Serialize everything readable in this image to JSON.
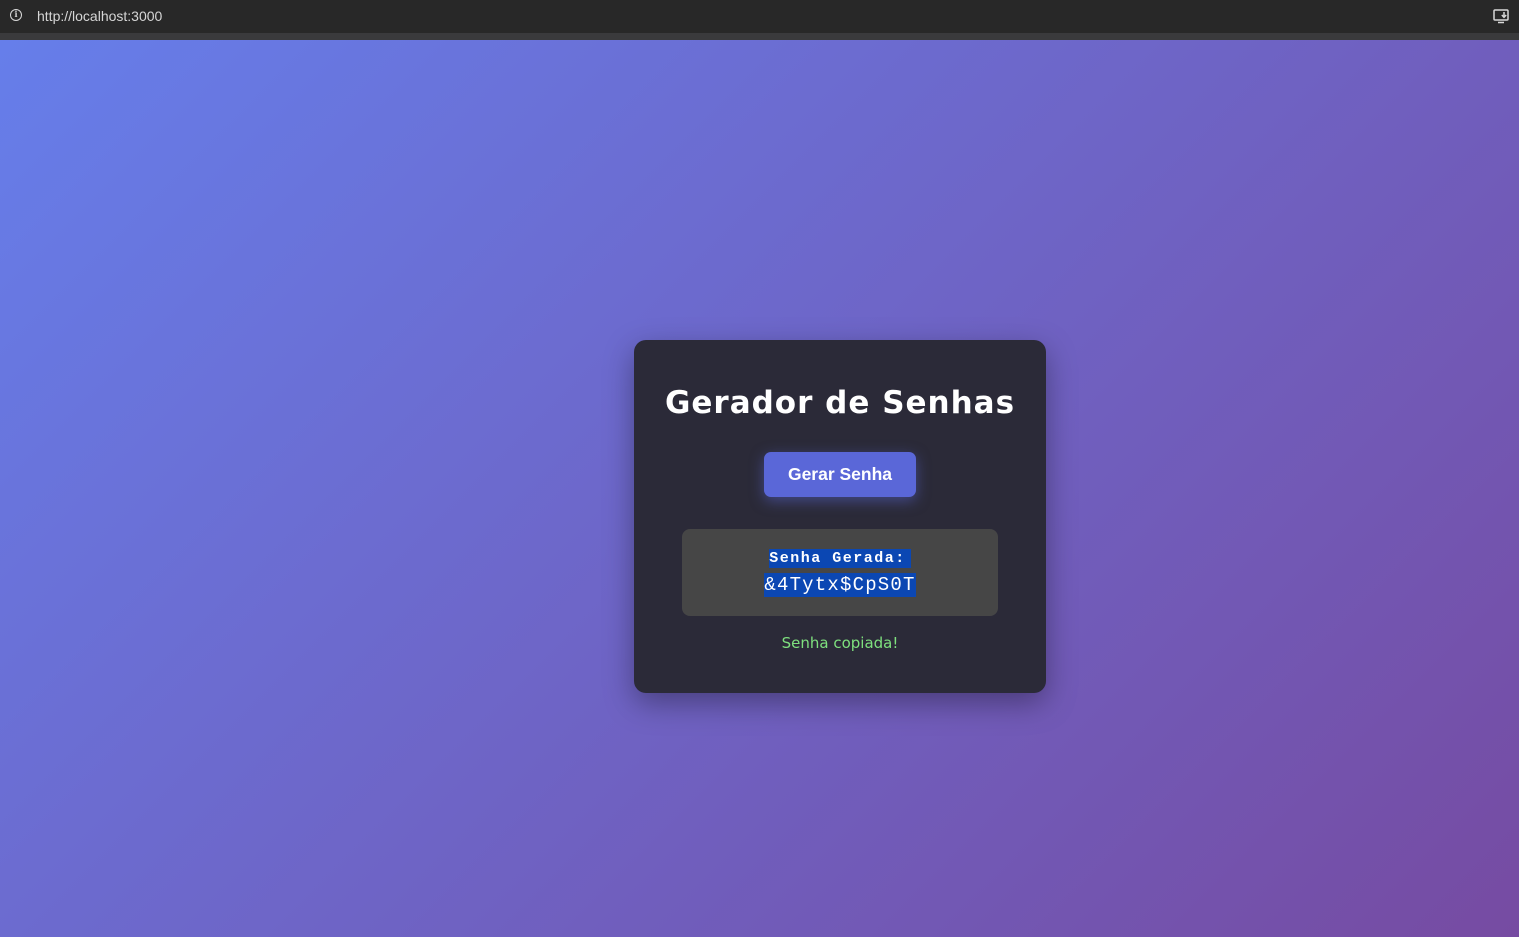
{
  "browser": {
    "url": "http://localhost:3000",
    "info_icon_glyph": "i"
  },
  "card": {
    "title": "Gerador de Senhas",
    "generate_button_label": "Gerar Senha",
    "result_label": "Senha Gerada:",
    "password_value": "&4Tytx$CpS0T",
    "copied_message": "Senha copiada!"
  },
  "colors": {
    "gradient_start": "#667eea",
    "gradient_end": "#764ba2",
    "card_bg": "#2b2a38",
    "button_bg": "#5a67d8",
    "result_bg": "#464646",
    "selection_highlight": "#0b47b3",
    "success_text": "#7ee07e"
  },
  "icons": {
    "site_info": "info-icon",
    "install_app": "install-app-icon"
  }
}
